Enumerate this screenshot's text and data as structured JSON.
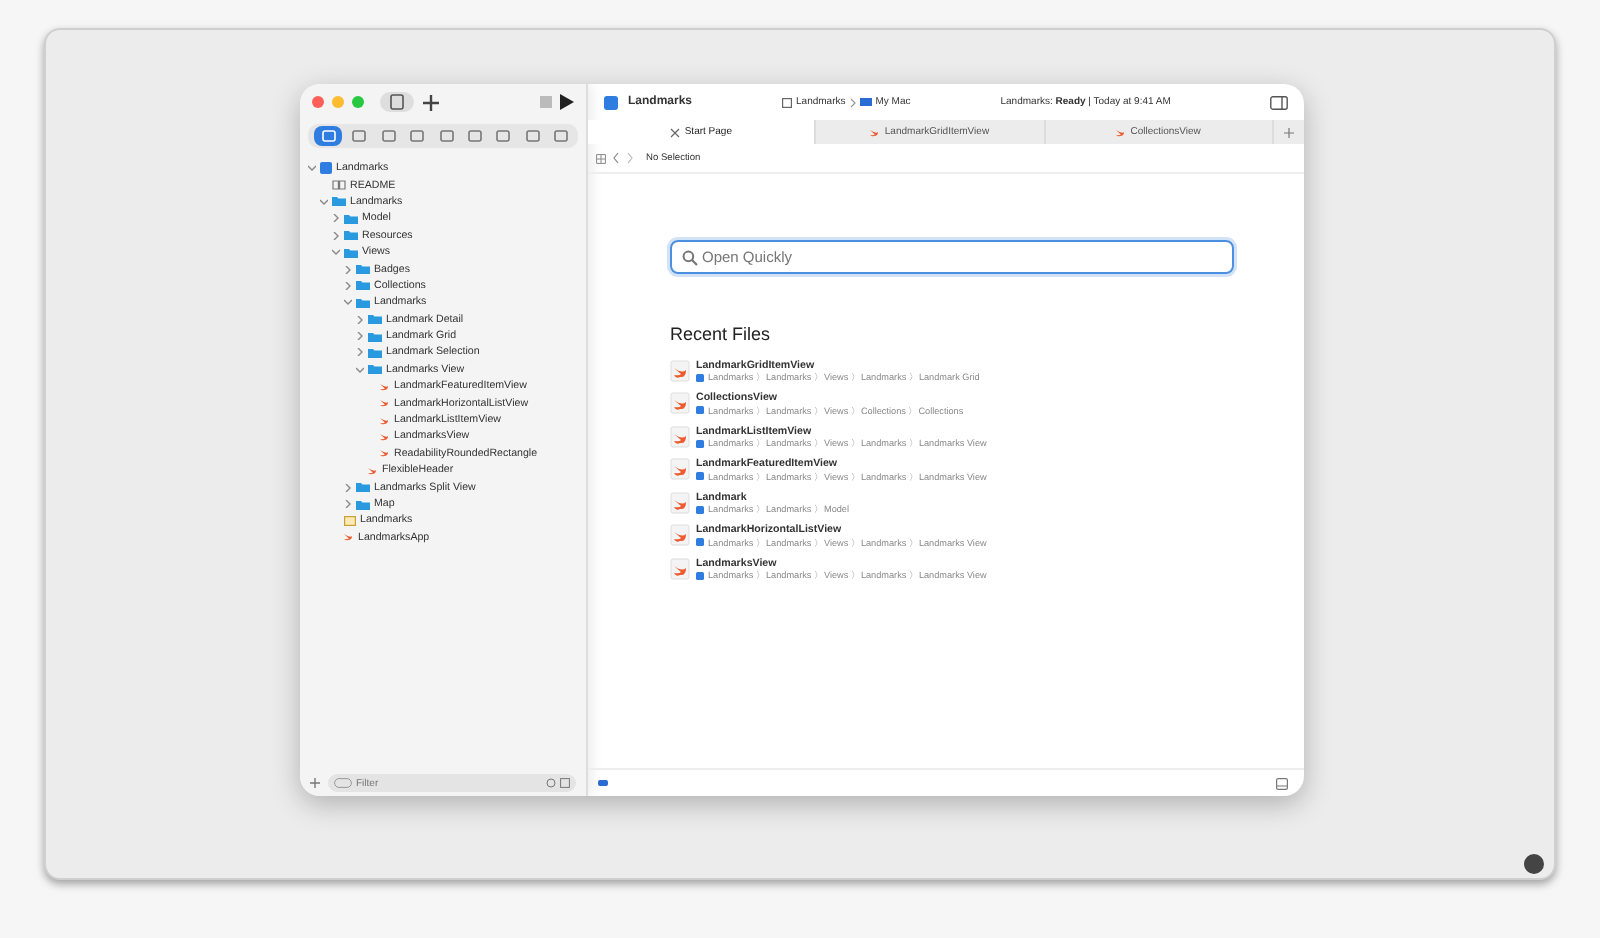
{
  "window": {
    "title": "Landmarks",
    "scheme": "Landmarks",
    "destination": "My Mac",
    "status": "Landmarks: **Ready** | Today at 9:41 AM"
  },
  "navigator_tabs": [
    {
      "selected": true
    },
    {
      "selected": false
    },
    {
      "selected": false
    },
    {
      "selected": false
    },
    {
      "selected": false
    },
    {
      "selected": false
    },
    {
      "selected": false
    },
    {
      "selected": false
    },
    {
      "selected": false
    }
  ],
  "tree": [
    {
      "label": "Landmarks",
      "kind": "project",
      "expanded": true,
      "children": [
        {
          "label": "README",
          "kind": "readme"
        },
        {
          "label": "Landmarks",
          "kind": "folder",
          "expanded": true,
          "children": [
            {
              "label": "Model",
              "kind": "folder",
              "expanded": false
            },
            {
              "label": "Resources",
              "kind": "folder",
              "expanded": false
            },
            {
              "label": "Views",
              "kind": "folder",
              "expanded": true,
              "children": [
                {
                  "label": "Badges",
                  "kind": "folder",
                  "expanded": false
                },
                {
                  "label": "Collections",
                  "kind": "folder",
                  "expanded": false
                },
                {
                  "label": "Landmarks",
                  "kind": "folder",
                  "expanded": true,
                  "children": [
                    {
                      "label": "Landmark Detail",
                      "kind": "folder",
                      "expanded": false
                    },
                    {
                      "label": "Landmark Grid",
                      "kind": "folder",
                      "expanded": false
                    },
                    {
                      "label": "Landmark Selection",
                      "kind": "folder",
                      "expanded": false
                    },
                    {
                      "label": "Landmarks View",
                      "kind": "folder",
                      "expanded": true,
                      "children": [
                        {
                          "label": "LandmarkFeaturedItemView",
                          "kind": "swift"
                        },
                        {
                          "label": "LandmarkHorizontalListView",
                          "kind": "swift"
                        },
                        {
                          "label": "LandmarkListItemView",
                          "kind": "swift"
                        },
                        {
                          "label": "LandmarksView",
                          "kind": "swift"
                        },
                        {
                          "label": "ReadabilityRoundedRectangle",
                          "kind": "swift"
                        }
                      ]
                    },
                    {
                      "label": "FlexibleHeader",
                      "kind": "swift"
                    }
                  ]
                },
                {
                  "label": "Landmarks Split View",
                  "kind": "folder",
                  "expanded": false
                },
                {
                  "label": "Map",
                  "kind": "folder",
                  "expanded": false
                }
              ]
            },
            {
              "label": "Landmarks",
              "kind": "assets"
            },
            {
              "label": "LandmarksApp",
              "kind": "swift"
            }
          ]
        }
      ]
    }
  ],
  "filter": {
    "placeholder": "Filter"
  },
  "editor_tabs": [
    {
      "label": "Start Page",
      "selected": true,
      "kind": "start"
    },
    {
      "label": "LandmarkGridItemView",
      "selected": false,
      "kind": "swift"
    },
    {
      "label": "CollectionsView",
      "selected": false,
      "kind": "swift"
    }
  ],
  "jump_bar": {
    "text": "No Selection"
  },
  "open_quickly": {
    "placeholder": "Open Quickly"
  },
  "recent_files": {
    "title": "Recent Files",
    "items": [
      {
        "name": "LandmarkGridItemView",
        "path": "Landmarks 〉Landmarks 〉Views 〉Landmarks 〉Landmark Grid"
      },
      {
        "name": "CollectionsView",
        "path": "Landmarks 〉Landmarks 〉Views 〉Collections 〉Collections"
      },
      {
        "name": "LandmarkListItemView",
        "path": "Landmarks 〉Landmarks 〉Views 〉Landmarks 〉Landmarks View"
      },
      {
        "name": "LandmarkFeaturedItemView",
        "path": "Landmarks 〉Landmarks 〉Views 〉Landmarks 〉Landmarks View"
      },
      {
        "name": "Landmark",
        "path": "Landmarks 〉Landmarks 〉Model"
      },
      {
        "name": "LandmarkHorizontalListView",
        "path": "Landmarks 〉Landmarks 〉Views 〉Landmarks 〉Landmarks View"
      },
      {
        "name": "LandmarksView",
        "path": "Landmarks 〉Landmarks 〉Views 〉Landmarks 〉Landmarks View"
      }
    ]
  }
}
